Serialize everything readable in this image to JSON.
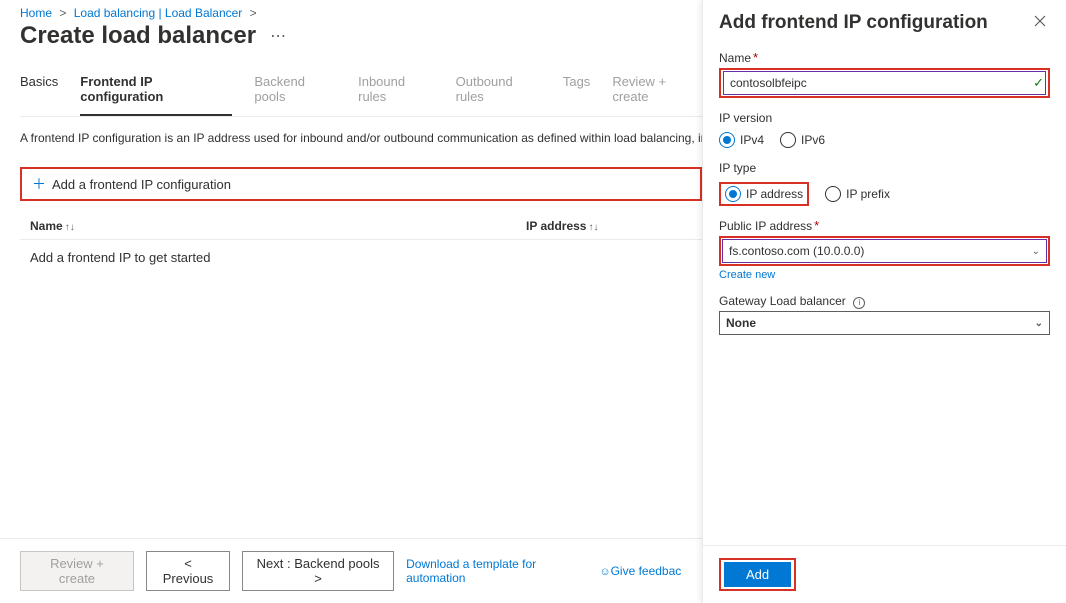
{
  "breadcrumb": {
    "home": "Home",
    "lb_service": "Load balancing | Load Balancer"
  },
  "page_title": "Create load balancer",
  "tabs": {
    "basics": "Basics",
    "frontend": "Frontend IP configuration",
    "backend": "Backend pools",
    "inbound": "Inbound rules",
    "outbound": "Outbound rules",
    "tags": "Tags",
    "review": "Review + create"
  },
  "description": "A frontend IP configuration is an IP address used for inbound and/or outbound communication as defined within load balancing, inbound NAT, and outbound rules.",
  "add_button_label": "Add a frontend IP configuration",
  "table": {
    "col_name": "Name",
    "col_ip": "IP address",
    "empty_msg": "Add a frontend IP to get started"
  },
  "footer": {
    "review": "Review + create",
    "previous": "< Previous",
    "next": "Next : Backend pools >",
    "download_link": "Download a template for automation",
    "feedback": "Give feedback"
  },
  "panel": {
    "title": "Add frontend IP configuration",
    "name_label": "Name",
    "name_value": "contosolbfeipc",
    "ip_version_label": "IP version",
    "ipv4": "IPv4",
    "ipv6": "IPv6",
    "ip_type_label": "IP type",
    "ip_address_opt": "IP address",
    "ip_prefix_opt": "IP prefix",
    "public_ip_label": "Public IP address",
    "public_ip_value": "fs.contoso.com (10.0.0.0)",
    "create_new": "Create new",
    "gateway_label": "Gateway Load balancer",
    "gateway_value": "None",
    "add_btn": "Add"
  }
}
